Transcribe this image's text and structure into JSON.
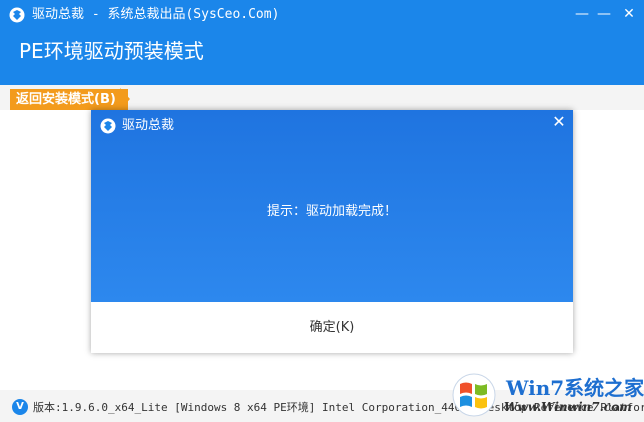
{
  "window": {
    "title": "驱动总裁 - 系统总裁出品(SysCeo.Com)",
    "heading": "PE环境驱动预装模式",
    "minimize_icon": "minimize-icon",
    "close_icon": "close-icon",
    "accent_color": "#1b86ea"
  },
  "back_tab": {
    "label": "返回安装模式(B)",
    "color": "#f39b1c"
  },
  "dialog": {
    "title": "驱动总裁",
    "message": "提示：驱动加载完成！",
    "ok_label": "确定(K)"
  },
  "status_bar": {
    "version_text": "版本:1.9.6.0_x64_Lite [Windows 8 x64 PE环境] Intel Corporation_440BX Desktop Reference Platform"
  },
  "watermark": {
    "name": "Win7系统之家",
    "url": "Www.Winwin7.com"
  }
}
